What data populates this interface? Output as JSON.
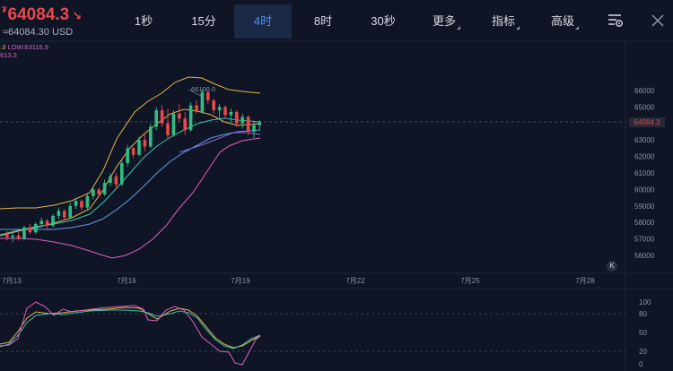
{
  "header": {
    "currency_symbol": "₮",
    "price": "64084.3",
    "price_arrow": "↘",
    "usd_price": "≈64084.30 USD"
  },
  "timeframes": [
    {
      "label": "1秒",
      "active": false
    },
    {
      "label": "15分",
      "active": false
    },
    {
      "label": "4时",
      "active": true
    },
    {
      "label": "8时",
      "active": false
    },
    {
      "label": "30秒",
      "active": false
    }
  ],
  "menus": {
    "more": "更多",
    "indicators": "指标",
    "advanced": "高级"
  },
  "legend": {
    "line1_a": ".3",
    "line1_b": "LOW:63116.9",
    "line2": "613.3"
  },
  "chart_data": {
    "type": "candlestick",
    "price_axis": [
      "66000",
      "65000",
      "64000",
      "63000",
      "62000",
      "61000",
      "60000",
      "59000",
      "58000",
      "57000",
      "56000"
    ],
    "current_price_label": "64084.3",
    "peak_annotation": "66100.0",
    "date_labels": [
      "7月13",
      "7月16",
      "7月19",
      "7月22",
      "7月25",
      "7月28"
    ],
    "oscillator_axis": [
      "100",
      "80",
      "50",
      "20",
      "0"
    ],
    "candles": [
      [
        57300,
        57500,
        56900,
        57100
      ],
      [
        57100,
        57400,
        56800,
        57200
      ],
      [
        57200,
        57500,
        56900,
        57000
      ],
      [
        57000,
        57800,
        56900,
        57700
      ],
      [
        57700,
        57900,
        57300,
        57400
      ],
      [
        57400,
        58000,
        57300,
        57900
      ],
      [
        57900,
        58300,
        57700,
        58100
      ],
      [
        58100,
        58200,
        57600,
        57800
      ],
      [
        57800,
        58500,
        57700,
        58400
      ],
      [
        58400,
        58900,
        58200,
        58700
      ],
      [
        58700,
        58800,
        58100,
        58300
      ],
      [
        58300,
        59200,
        58200,
        59000
      ],
      [
        59000,
        59500,
        58800,
        59300
      ],
      [
        59300,
        59400,
        58700,
        58900
      ],
      [
        58900,
        59800,
        58800,
        59600
      ],
      [
        59600,
        60200,
        59400,
        60000
      ],
      [
        60000,
        60100,
        59500,
        59700
      ],
      [
        59700,
        60600,
        59600,
        60400
      ],
      [
        60400,
        61000,
        60200,
        60800
      ],
      [
        60800,
        61000,
        60000,
        60300
      ],
      [
        60300,
        61800,
        60200,
        61600
      ],
      [
        61600,
        62700,
        61400,
        62500
      ],
      [
        62500,
        62600,
        61900,
        62100
      ],
      [
        62100,
        63200,
        62000,
        63000
      ],
      [
        63000,
        63400,
        62300,
        62600
      ],
      [
        62600,
        64000,
        62500,
        63800
      ],
      [
        63800,
        65000,
        63600,
        64800
      ],
      [
        64800,
        65100,
        63800,
        64000
      ],
      [
        64000,
        64900,
        63100,
        63300
      ],
      [
        63300,
        64800,
        63200,
        64600
      ],
      [
        64600,
        65200,
        64100,
        64300
      ],
      [
        64300,
        64700,
        63300,
        63600
      ],
      [
        63600,
        65300,
        63500,
        65100
      ],
      [
        65100,
        65400,
        64600,
        64700
      ],
      [
        64700,
        66100,
        64600,
        65900
      ],
      [
        65900,
        66000,
        65200,
        65400
      ],
      [
        65400,
        65500,
        64600,
        64800
      ],
      [
        64800,
        65200,
        64300,
        65000
      ],
      [
        65000,
        65100,
        64300,
        64500
      ],
      [
        64500,
        64900,
        64000,
        64700
      ],
      [
        64700,
        64800,
        63800,
        64000
      ],
      [
        64000,
        64600,
        63700,
        64400
      ],
      [
        64400,
        64500,
        63300,
        63500
      ],
      [
        63500,
        64100,
        63116.9,
        63900
      ],
      [
        63900,
        64200,
        63600,
        64084.3
      ]
    ]
  }
}
